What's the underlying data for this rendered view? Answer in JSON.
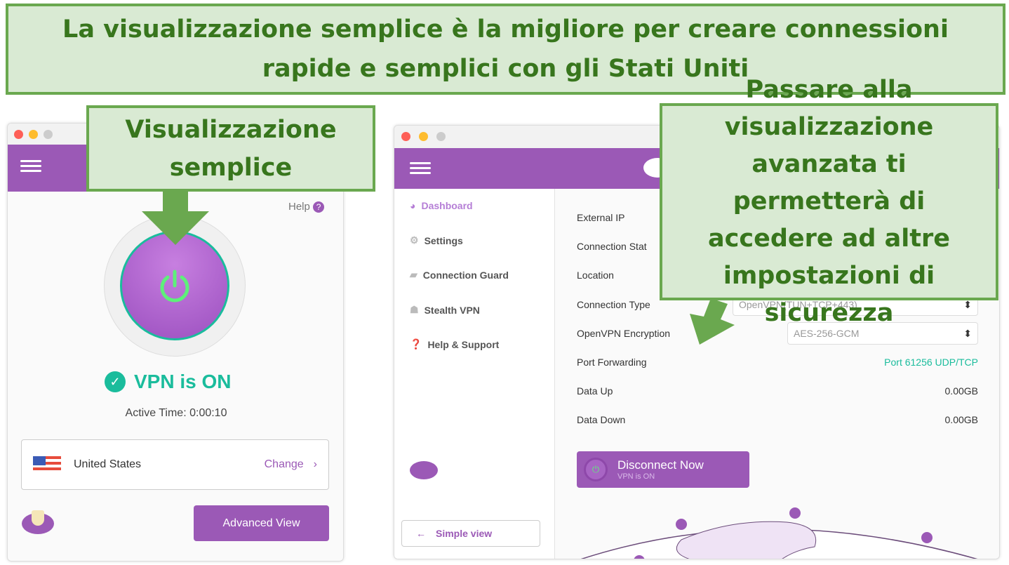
{
  "banner": {
    "text": "La visualizzazione semplice è la migliore per creare connessioni rapide e semplici con gli Stati Uniti"
  },
  "callout_left": {
    "text": "Visualizzazione semplice"
  },
  "callout_right": {
    "text": "Passare alla visualizzazione avanzata ti permetterà di accedere ad altre impostazioni di sicurezza"
  },
  "simple": {
    "help": "Help",
    "status": "VPN is ON",
    "active_time": "Active Time: 0:00:10",
    "country": "United States",
    "change": "Change",
    "advanced_button": "Advanced View"
  },
  "advanced": {
    "sidebar": [
      {
        "label": "Dashboard",
        "icon": "dashboard-icon",
        "active": true
      },
      {
        "label": "Settings",
        "icon": "gear-icon"
      },
      {
        "label": "Connection Guard",
        "icon": "tag-icon"
      },
      {
        "label": "Stealth VPN",
        "icon": "stealth-icon"
      },
      {
        "label": "Help & Support",
        "icon": "help-icon"
      }
    ],
    "simple_view": "Simple view",
    "rows": [
      {
        "label": "External IP",
        "value": ""
      },
      {
        "label": "Connection Stat",
        "value": ""
      },
      {
        "label": "Location",
        "value": ""
      },
      {
        "label": "Connection Type",
        "value": "OpenVPN(TUN+TCP+443)"
      },
      {
        "label": "OpenVPN Encryption",
        "value": "AES-256-GCM"
      },
      {
        "label": "Port Forwarding",
        "value": "Port 61256 UDP/TCP"
      },
      {
        "label": "Data Up",
        "value": "0.00GB"
      },
      {
        "label": "Data Down",
        "value": "0.00GB"
      }
    ],
    "disconnect": "Disconnect Now",
    "disconnect_sub": "VPN is ON"
  },
  "colors": {
    "purple": "#9b59b6",
    "teal": "#1abc9c",
    "green_callout": "#6aa84f"
  }
}
